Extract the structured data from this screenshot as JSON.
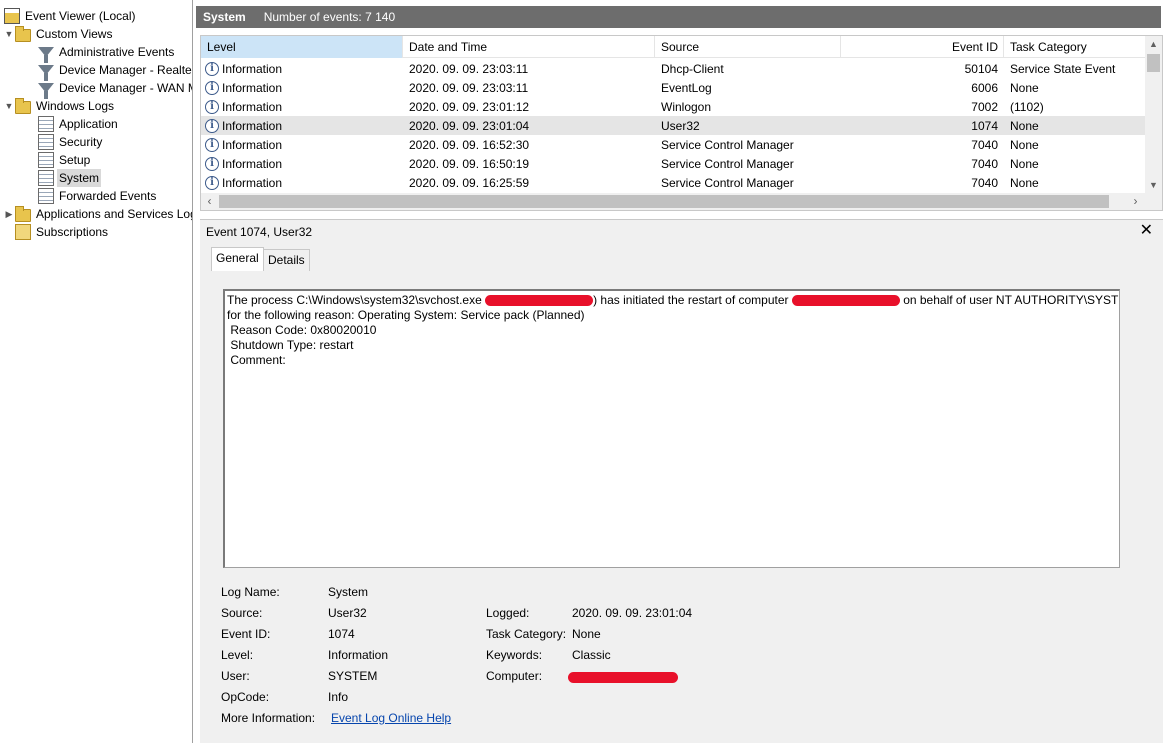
{
  "tree": {
    "root": "Event Viewer (Local)",
    "custom_views": "Custom Views",
    "custom_children": [
      "Administrative Events",
      "Device Manager - Realtek",
      "Device Manager - WAN Miniport"
    ],
    "windows_logs": "Windows Logs",
    "logs": [
      "Application",
      "Security",
      "Setup",
      "System",
      "Forwarded Events"
    ],
    "apps_services": "Applications and Services Logs",
    "subscriptions": "Subscriptions",
    "selected": "System"
  },
  "header": {
    "title": "System",
    "count": "Number of events: 7 140"
  },
  "grid": {
    "columns": [
      "Level",
      "Date and Time",
      "Source",
      "Event ID",
      "Task Category"
    ],
    "rows": [
      {
        "level": "Information",
        "date": "2020. 09. 09. 23:03:11",
        "source": "Dhcp-Client",
        "id": "50104",
        "task": "Service State Event"
      },
      {
        "level": "Information",
        "date": "2020. 09. 09. 23:03:11",
        "source": "EventLog",
        "id": "6006",
        "task": "None"
      },
      {
        "level": "Information",
        "date": "2020. 09. 09. 23:01:12",
        "source": "Winlogon",
        "id": "7002",
        "task": "(1102)"
      },
      {
        "level": "Information",
        "date": "2020. 09. 09. 23:01:04",
        "source": "User32",
        "id": "1074",
        "task": "None"
      },
      {
        "level": "Information",
        "date": "2020. 09. 09. 16:52:30",
        "source": "Service Control Manager",
        "id": "7040",
        "task": "None"
      },
      {
        "level": "Information",
        "date": "2020. 09. 09. 16:50:19",
        "source": "Service Control Manager",
        "id": "7040",
        "task": "None"
      },
      {
        "level": "Information",
        "date": "2020. 09. 09. 16:25:59",
        "source": "Service Control Manager",
        "id": "7040",
        "task": "None"
      }
    ],
    "selected_index": 3
  },
  "detail": {
    "title": "Event 1074, User32",
    "tabs": [
      "General",
      "Details"
    ],
    "message": {
      "line1_a": "The process C:\\Windows\\system32\\svchost.exe ",
      "line1_b": ") has initiated the restart of computer ",
      "line1_c": " on behalf of user NT AUTHORITY\\SYSTEM",
      "line2": "for the following reason: Operating System: Service pack (Planned)",
      "line3": " Reason Code: 0x80020010",
      "line4": " Shutdown Type: restart",
      "line5": " Comment:"
    },
    "fields": {
      "log_name_label": "Log Name:",
      "log_name": "System",
      "source_label": "Source:",
      "source": "User32",
      "logged_label": "Logged:",
      "logged": "2020. 09. 09. 23:01:04",
      "event_id_label": "Event ID:",
      "event_id": "1074",
      "task_label": "Task Category:",
      "task": "None",
      "level_label": "Level:",
      "level": "Information",
      "keywords_label": "Keywords:",
      "keywords": "Classic",
      "user_label": "User:",
      "user": "SYSTEM",
      "computer_label": "Computer:",
      "opcode_label": "OpCode:",
      "opcode": "Info",
      "more_label": "More Information:",
      "more_link": "Event Log Online Help"
    }
  },
  "colors": {
    "header_bg": "#6d6d6d",
    "selected_col_bg": "#cce4f7",
    "row_highlight": "#e5e5e5",
    "redaction": "#e8102a",
    "link": "#0645ad"
  }
}
